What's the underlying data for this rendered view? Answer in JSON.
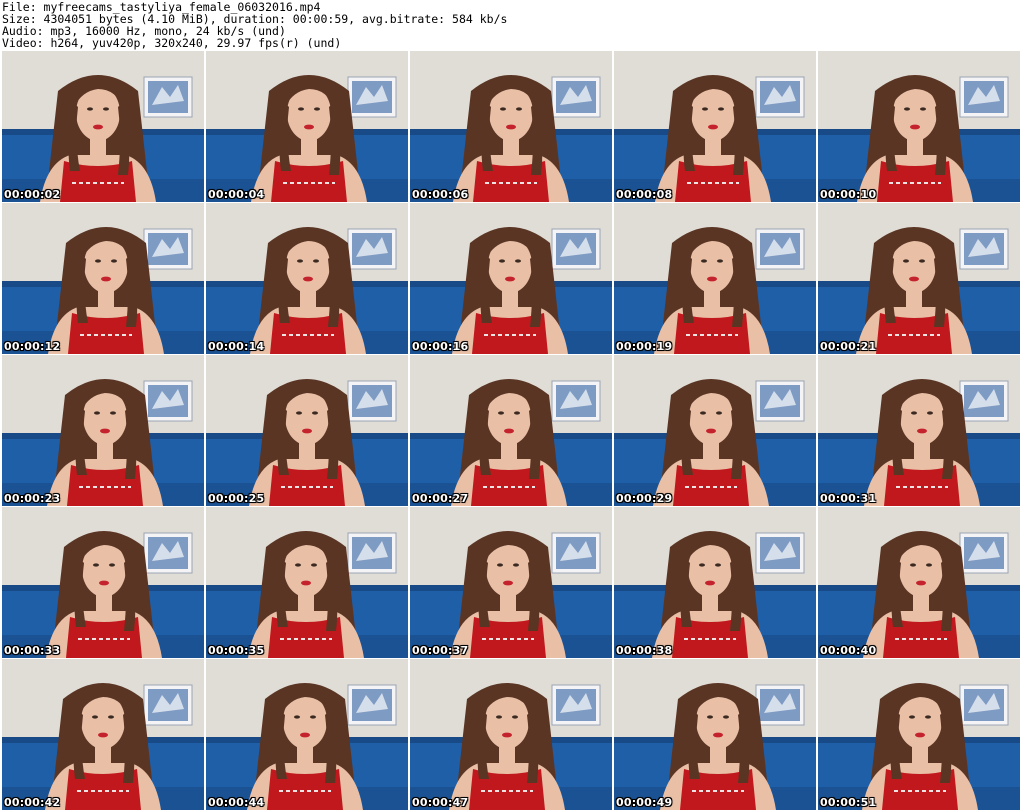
{
  "header": {
    "file_line": "File: myfreecams_tastyliya_female_06032016.mp4",
    "size_line": "Size: 4304051 bytes (4.10 MiB), duration: 00:00:59, avg.bitrate: 584 kb/s",
    "audio_line": "Audio: mp3, 16000 Hz, mono, 24 kb/s (und)",
    "video_line": "Video: h264, yuv420p, 320x240, 29.97 fps(r) (und)"
  },
  "colors": {
    "wall": "#e4e0da",
    "sofa": "#1f5fa8",
    "sofa_dark": "#174a86",
    "top": "#c0181c",
    "hair": "#5a3524",
    "skin": "#e9bfa6",
    "lips": "#c4222c"
  },
  "thumbnails": [
    "00:00:02",
    "00:00:04",
    "00:00:06",
    "00:00:08",
    "00:00:10",
    "00:00:12",
    "00:00:14",
    "00:00:16",
    "00:00:19",
    "00:00:21",
    "00:00:23",
    "00:00:25",
    "00:00:27",
    "00:00:29",
    "00:00:31",
    "00:00:33",
    "00:00:35",
    "00:00:37",
    "00:00:38",
    "00:00:40",
    "00:00:42",
    "00:00:44",
    "00:00:47",
    "00:00:49",
    "00:00:51"
  ]
}
